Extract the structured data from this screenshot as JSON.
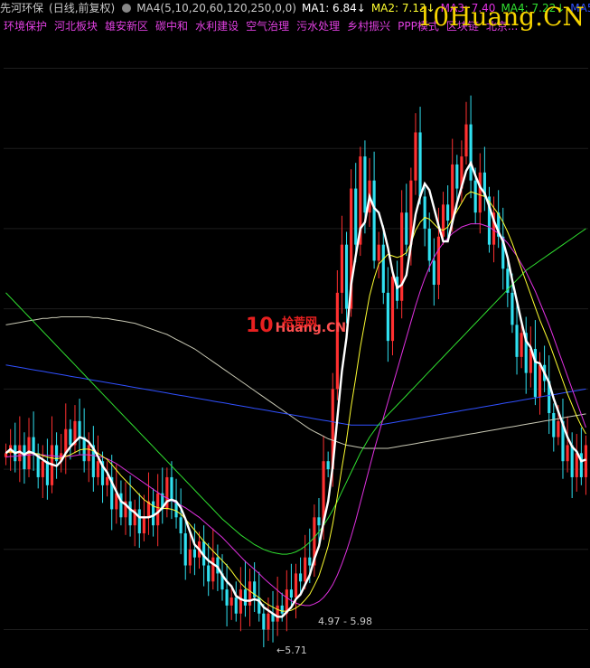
{
  "header": {
    "stock_name": "先河环保",
    "period": "(日线,前复权)",
    "indicator": "MA4(5,10,20,60,120,250,0,0)",
    "ma1": "MA1: 6.84↓",
    "ma2": "MA2: 7.13↓",
    "ma3": "MA3: 7.40",
    "ma4": "MA4: 7.22↓",
    "ma5": "MA5: 7.3"
  },
  "tags": [
    "环境保护",
    "河北板块",
    "雄安新区",
    "碳中和",
    "水利建设",
    "空气治理",
    "污水处理",
    "乡村振兴",
    "PPP模式",
    "区块链",
    "北京..."
  ],
  "watermarks": {
    "top": "10Huang.CN",
    "mid_num": "10",
    "mid_cn": "拾荒网",
    "mid_en": "Huang.CN"
  },
  "annotations": {
    "range_label": "4.97 - 5.98",
    "low_label": "←5.71"
  },
  "colors": {
    "up": "#ff3030",
    "down": "#30e0f0",
    "ma1": "#ffffff",
    "ma2": "#ffff30",
    "ma3": "#e030e0",
    "ma4": "#30e030",
    "ma5": "#3050ff",
    "ma6": "#c8c8b4"
  },
  "chart_data": {
    "type": "candlestick",
    "ylim": [
      4.6,
      12.4
    ],
    "closes": [
      7.2,
      7.3,
      7.1,
      7.3,
      7.0,
      7.4,
      7.2,
      6.9,
      7.1,
      6.8,
      7.3,
      7.1,
      7.2,
      7.5,
      7.3,
      7.6,
      7.4,
      7.1,
      7.3,
      6.9,
      7.1,
      6.8,
      6.9,
      6.5,
      6.7,
      6.4,
      6.6,
      6.3,
      6.5,
      6.2,
      6.4,
      6.6,
      6.3,
      6.7,
      6.5,
      6.9,
      6.6,
      6.4,
      6.2,
      5.8,
      6.0,
      5.9,
      6.1,
      5.8,
      5.6,
      5.9,
      5.7,
      5.5,
      5.3,
      5.4,
      5.2,
      5.5,
      5.3,
      5.6,
      5.4,
      5.2,
      5.0,
      5.2,
      5.1,
      5.3,
      5.2,
      5.5,
      5.4,
      5.7,
      5.6,
      5.9,
      5.8,
      6.4,
      6.3,
      7.1,
      7.0,
      8.0,
      9.2,
      9.8,
      9.0,
      10.5,
      9.8,
      10.9,
      10.2,
      10.6,
      9.6,
      9.8,
      9.2,
      8.6,
      9.4,
      9.1,
      10.2,
      9.8,
      10.6,
      11.2,
      10.4,
      10.0,
      9.6,
      9.3,
      9.9,
      10.3,
      10.1,
      10.8,
      10.5,
      10.9,
      11.3,
      10.6,
      10.2,
      10.7,
      10.4,
      9.8,
      10.2,
      9.9,
      9.5,
      9.2,
      8.8,
      8.4,
      8.7,
      8.2,
      8.5,
      7.9,
      8.3,
      8.1,
      7.7,
      7.4,
      7.6,
      7.1,
      7.3,
      6.9,
      7.2,
      6.9,
      7.3
    ],
    "ma_series": [
      {
        "name": "MA1",
        "values": [
          7.2,
          7.25,
          7.2,
          7.22,
          7.18,
          7.22,
          7.2,
          7.16,
          7.12,
          7.08,
          7.06,
          7.04,
          7.1,
          7.2,
          7.28,
          7.34,
          7.4,
          7.38,
          7.34,
          7.26,
          7.16,
          7.04,
          6.96,
          6.84,
          6.72,
          6.6,
          6.56,
          6.5,
          6.46,
          6.4,
          6.4,
          6.4,
          6.42,
          6.46,
          6.52,
          6.6,
          6.62,
          6.6,
          6.52,
          6.38,
          6.22,
          6.06,
          6.0,
          5.92,
          5.86,
          5.82,
          5.78,
          5.68,
          5.6,
          5.54,
          5.42,
          5.38,
          5.36,
          5.36,
          5.38,
          5.36,
          5.28,
          5.24,
          5.2,
          5.16,
          5.16,
          5.22,
          5.28,
          5.38,
          5.44,
          5.56,
          5.68,
          5.88,
          6.04,
          6.34,
          6.6,
          7.04,
          7.64,
          8.22,
          8.64,
          9.3,
          9.66,
          10.0,
          10.08,
          10.4,
          10.26,
          10.2,
          10.0,
          9.76,
          9.46,
          9.26,
          9.3,
          9.42,
          9.8,
          10.18,
          10.4,
          10.56,
          10.48,
          10.26,
          10.04,
          9.84,
          9.84,
          10.08,
          10.32,
          10.52,
          10.72,
          10.82,
          10.66,
          10.52,
          10.44,
          10.28,
          10.1,
          9.96,
          9.84,
          9.64,
          9.36,
          9.1,
          8.84,
          8.6,
          8.52,
          8.34,
          8.32,
          8.2,
          8.08,
          7.88,
          7.72,
          7.56,
          7.4,
          7.28,
          7.22,
          7.1,
          7.12
        ]
      },
      {
        "name": "MA2",
        "values": [
          7.2,
          7.22,
          7.2,
          7.21,
          7.19,
          7.2,
          7.2,
          7.19,
          7.17,
          7.15,
          7.14,
          7.13,
          7.14,
          7.16,
          7.18,
          7.21,
          7.24,
          7.25,
          7.25,
          7.23,
          7.2,
          7.16,
          7.12,
          7.06,
          6.99,
          6.92,
          6.86,
          6.8,
          6.74,
          6.68,
          6.62,
          6.58,
          6.54,
          6.52,
          6.51,
          6.51,
          6.5,
          6.48,
          6.44,
          6.38,
          6.31,
          6.24,
          6.17,
          6.1,
          6.04,
          5.98,
          5.92,
          5.86,
          5.8,
          5.73,
          5.65,
          5.58,
          5.52,
          5.48,
          5.44,
          5.4,
          5.35,
          5.31,
          5.28,
          5.25,
          5.23,
          5.23,
          5.24,
          5.27,
          5.31,
          5.37,
          5.44,
          5.55,
          5.67,
          5.85,
          6.04,
          6.32,
          6.66,
          7.02,
          7.36,
          7.78,
          8.14,
          8.52,
          8.84,
          9.16,
          9.38,
          9.56,
          9.62,
          9.68,
          9.66,
          9.64,
          9.66,
          9.7,
          9.82,
          9.98,
          10.08,
          10.14,
          10.12,
          10.06,
          10.0,
          9.98,
          10.02,
          10.12,
          10.22,
          10.32,
          10.42,
          10.46,
          10.44,
          10.42,
          10.4,
          10.34,
          10.26,
          10.18,
          10.08,
          9.96,
          9.82,
          9.66,
          9.5,
          9.34,
          9.18,
          9.02,
          8.86,
          8.72,
          8.58,
          8.42,
          8.26,
          8.1,
          7.94,
          7.8,
          7.66,
          7.54,
          7.44
        ]
      },
      {
        "name": "MA3",
        "values": [
          7.15,
          7.16,
          7.16,
          7.17,
          7.17,
          7.18,
          7.18,
          7.18,
          7.18,
          7.17,
          7.17,
          7.16,
          7.16,
          7.16,
          7.16,
          7.17,
          7.18,
          7.18,
          7.18,
          7.17,
          7.16,
          7.15,
          7.13,
          7.1,
          7.07,
          7.03,
          6.99,
          6.95,
          6.91,
          6.87,
          6.83,
          6.79,
          6.75,
          6.71,
          6.67,
          6.64,
          6.61,
          6.58,
          6.55,
          6.52,
          6.48,
          6.44,
          6.4,
          6.35,
          6.3,
          6.25,
          6.2,
          6.15,
          6.09,
          6.03,
          5.97,
          5.91,
          5.85,
          5.8,
          5.75,
          5.7,
          5.64,
          5.59,
          5.54,
          5.49,
          5.44,
          5.4,
          5.36,
          5.33,
          5.31,
          5.3,
          5.3,
          5.32,
          5.35,
          5.4,
          5.47,
          5.56,
          5.68,
          5.82,
          5.98,
          6.16,
          6.36,
          6.58,
          6.8,
          7.02,
          7.24,
          7.44,
          7.64,
          7.84,
          8.04,
          8.24,
          8.44,
          8.64,
          8.84,
          9.04,
          9.22,
          9.38,
          9.52,
          9.64,
          9.74,
          9.82,
          9.88,
          9.94,
          9.98,
          10.02,
          10.04,
          10.06,
          10.06,
          10.06,
          10.04,
          10.02,
          9.98,
          9.94,
          9.88,
          9.82,
          9.74,
          9.66,
          9.56,
          9.46,
          9.34,
          9.22,
          9.08,
          8.94,
          8.8,
          8.64,
          8.48,
          8.32,
          8.16,
          8.0,
          7.84,
          7.68,
          7.52
        ]
      },
      {
        "name": "MA4",
        "values": [
          9.2,
          9.14,
          9.08,
          9.02,
          8.96,
          8.9,
          8.84,
          8.78,
          8.72,
          8.66,
          8.6,
          8.54,
          8.48,
          8.42,
          8.36,
          8.3,
          8.24,
          8.18,
          8.12,
          8.06,
          8.0,
          7.94,
          7.88,
          7.82,
          7.76,
          7.7,
          7.64,
          7.58,
          7.52,
          7.46,
          7.4,
          7.34,
          7.28,
          7.22,
          7.16,
          7.1,
          7.04,
          6.98,
          6.92,
          6.86,
          6.8,
          6.74,
          6.68,
          6.62,
          6.56,
          6.5,
          6.44,
          6.38,
          6.33,
          6.28,
          6.23,
          6.18,
          6.14,
          6.1,
          6.06,
          6.03,
          6.0,
          5.98,
          5.96,
          5.95,
          5.94,
          5.94,
          5.95,
          5.97,
          6.0,
          6.04,
          6.09,
          6.15,
          6.22,
          6.3,
          6.39,
          6.49,
          6.6,
          6.72,
          6.84,
          6.96,
          7.08,
          7.2,
          7.3,
          7.4,
          7.48,
          7.56,
          7.62,
          7.68,
          7.74,
          7.8,
          7.86,
          7.92,
          7.98,
          8.04,
          8.1,
          8.16,
          8.22,
          8.28,
          8.34,
          8.4,
          8.46,
          8.52,
          8.58,
          8.64,
          8.7,
          8.76,
          8.82,
          8.88,
          8.94,
          9.0,
          9.06,
          9.12,
          9.18,
          9.24,
          9.3,
          9.36,
          9.42,
          9.48,
          9.52,
          9.56,
          9.6,
          9.64,
          9.68,
          9.72,
          9.76,
          9.8,
          9.84,
          9.88,
          9.92,
          9.96,
          10.0
        ]
      },
      {
        "name": "MA5",
        "values": [
          8.3,
          8.29,
          8.28,
          8.27,
          8.26,
          8.25,
          8.24,
          8.23,
          8.22,
          8.21,
          8.2,
          8.19,
          8.18,
          8.17,
          8.16,
          8.15,
          8.14,
          8.13,
          8.12,
          8.11,
          8.1,
          8.09,
          8.08,
          8.07,
          8.06,
          8.05,
          8.04,
          8.03,
          8.02,
          8.01,
          8.0,
          7.99,
          7.98,
          7.97,
          7.96,
          7.95,
          7.94,
          7.93,
          7.92,
          7.91,
          7.9,
          7.89,
          7.88,
          7.87,
          7.86,
          7.85,
          7.84,
          7.83,
          7.82,
          7.81,
          7.8,
          7.79,
          7.78,
          7.77,
          7.76,
          7.75,
          7.74,
          7.73,
          7.72,
          7.71,
          7.7,
          7.69,
          7.68,
          7.67,
          7.66,
          7.65,
          7.64,
          7.63,
          7.62,
          7.61,
          7.6,
          7.59,
          7.58,
          7.57,
          7.56,
          7.55,
          7.55,
          7.55,
          7.55,
          7.55,
          7.55,
          7.55,
          7.56,
          7.57,
          7.58,
          7.59,
          7.6,
          7.61,
          7.62,
          7.63,
          7.64,
          7.65,
          7.66,
          7.67,
          7.68,
          7.69,
          7.7,
          7.71,
          7.72,
          7.73,
          7.74,
          7.75,
          7.76,
          7.77,
          7.78,
          7.79,
          7.8,
          7.81,
          7.82,
          7.83,
          7.84,
          7.85,
          7.86,
          7.87,
          7.88,
          7.89,
          7.9,
          7.91,
          7.92,
          7.93,
          7.94,
          7.95,
          7.96,
          7.97,
          7.98,
          7.99,
          8.0
        ]
      },
      {
        "name": "MA6",
        "values": [
          8.8,
          8.81,
          8.82,
          8.83,
          8.84,
          8.85,
          8.86,
          8.87,
          8.88,
          8.88,
          8.89,
          8.89,
          8.9,
          8.9,
          8.9,
          8.9,
          8.9,
          8.9,
          8.9,
          8.89,
          8.89,
          8.88,
          8.88,
          8.87,
          8.86,
          8.85,
          8.84,
          8.83,
          8.82,
          8.8,
          8.78,
          8.76,
          8.74,
          8.72,
          8.7,
          8.68,
          8.65,
          8.62,
          8.59,
          8.56,
          8.53,
          8.5,
          8.46,
          8.42,
          8.38,
          8.34,
          8.3,
          8.26,
          8.22,
          8.18,
          8.14,
          8.1,
          8.06,
          8.02,
          7.98,
          7.94,
          7.9,
          7.86,
          7.82,
          7.78,
          7.74,
          7.7,
          7.66,
          7.62,
          7.58,
          7.54,
          7.5,
          7.47,
          7.44,
          7.41,
          7.38,
          7.36,
          7.34,
          7.32,
          7.3,
          7.29,
          7.28,
          7.27,
          7.26,
          7.26,
          7.26,
          7.26,
          7.26,
          7.26,
          7.27,
          7.28,
          7.29,
          7.3,
          7.31,
          7.32,
          7.33,
          7.34,
          7.35,
          7.36,
          7.37,
          7.38,
          7.39,
          7.4,
          7.41,
          7.42,
          7.43,
          7.44,
          7.45,
          7.46,
          7.47,
          7.48,
          7.49,
          7.5,
          7.51,
          7.52,
          7.53,
          7.54,
          7.55,
          7.56,
          7.57,
          7.58,
          7.59,
          7.6,
          7.61,
          7.62,
          7.63,
          7.64,
          7.65,
          7.66,
          7.67,
          7.68,
          7.69
        ]
      }
    ]
  }
}
